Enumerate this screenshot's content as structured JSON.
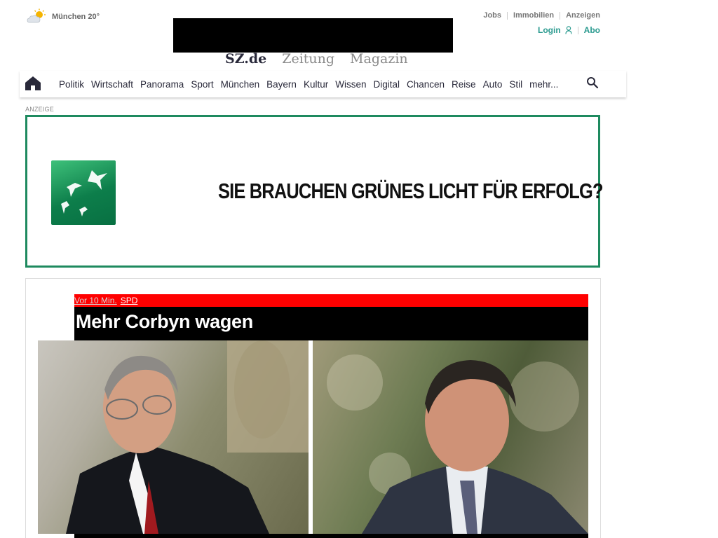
{
  "weather": {
    "label": "München 20°",
    "icon": "sun-cloud-icon"
  },
  "top_links": [
    "Jobs",
    "Immobilien",
    "Anzeigen"
  ],
  "user_links": {
    "login": "Login",
    "abo": "Abo"
  },
  "brand": {
    "main": "SZ.de",
    "zeitung": "Zeitung",
    "magazin": "Magazin"
  },
  "nav": {
    "items": [
      "Politik",
      "Wirtschaft",
      "Panorama",
      "Sport",
      "München",
      "Bayern",
      "Kultur",
      "Wissen",
      "Digital",
      "Chancen",
      "Reise",
      "Auto",
      "Stil",
      "mehr..."
    ]
  },
  "ad": {
    "label": "ANZEIGE",
    "headline": "SIE BRAUCHEN GRÜNES LICHT FÜR ERFOLG?",
    "brand_color": "#1e8a5f"
  },
  "teaser": {
    "time": "Vor 10 Min.",
    "topic": "SPD",
    "title": "Mehr Corbyn wagen",
    "meta_color": "#ff0000"
  },
  "colors": {
    "accent": "#2a9a8f",
    "text": "#29293a"
  }
}
